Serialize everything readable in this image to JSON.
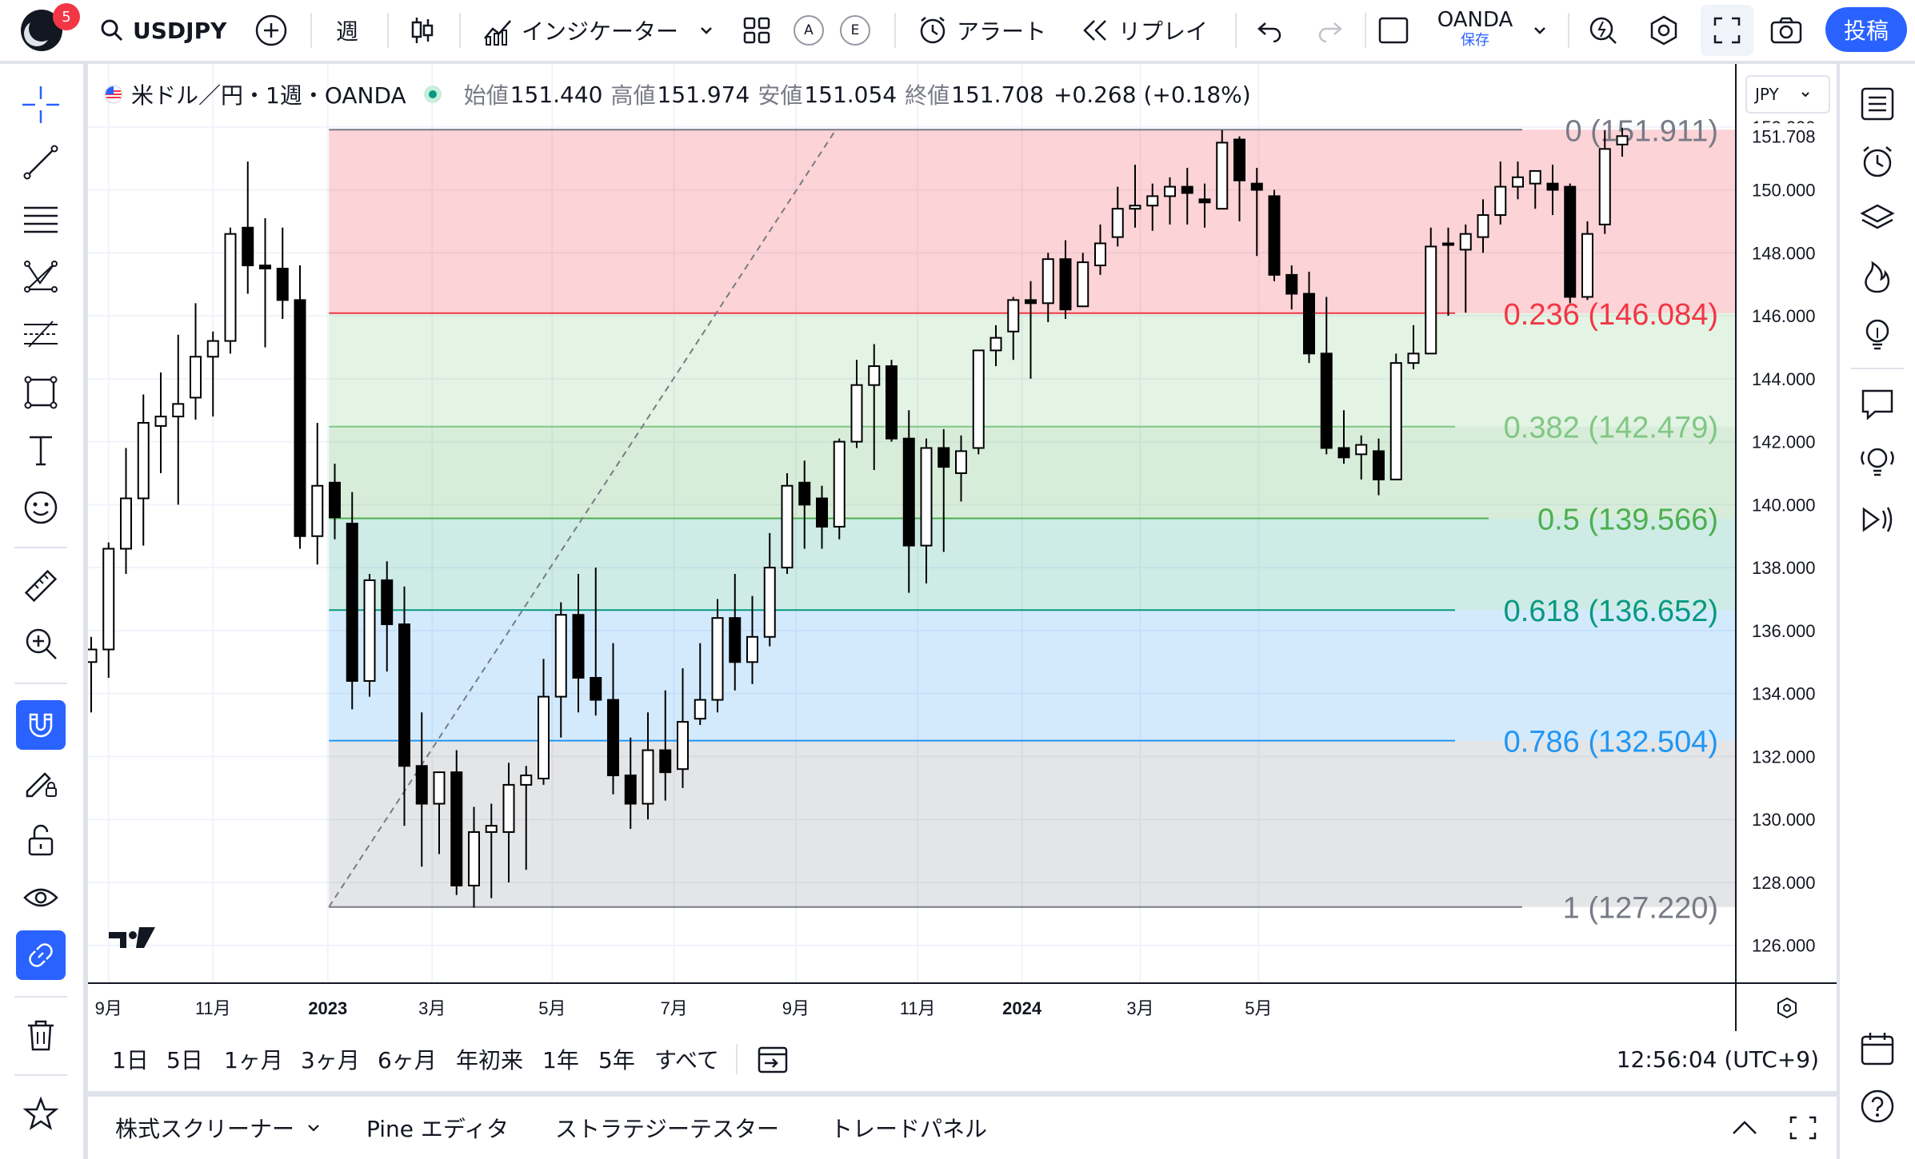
{
  "header": {
    "notification_count": "5",
    "symbol": "USDJPY",
    "interval": "週",
    "indicators_label": "インジケーター",
    "alert_label": "アラート",
    "replay_label": "リプレイ",
    "layout_name": "OANDA",
    "layout_status": "保存",
    "post_label": "投稿",
    "circle_a": "A",
    "circle_e": "E"
  },
  "legend": {
    "title": "米ドル／円・1週・OANDA",
    "open_label": "始値",
    "open": "151.440",
    "high_label": "高値",
    "high": "151.974",
    "low_label": "安値",
    "low": "151.054",
    "close_label": "終値",
    "close": "151.708",
    "change": "+0.268 (+0.18%)"
  },
  "currency": "JPY",
  "price_axis": {
    "ticks": [
      "152.000",
      "150.000",
      "148.000",
      "146.000",
      "144.000",
      "142.000",
      "140.000",
      "138.000",
      "136.000",
      "134.000",
      "132.000",
      "130.000",
      "128.000",
      "126.000"
    ],
    "last_price": "151.708"
  },
  "time_axis": {
    "labels": [
      {
        "text": "9月",
        "bold": false
      },
      {
        "text": "11月",
        "bold": false
      },
      {
        "text": "2023",
        "bold": true
      },
      {
        "text": "3月",
        "bold": false
      },
      {
        "text": "5月",
        "bold": false
      },
      {
        "text": "7月",
        "bold": false
      },
      {
        "text": "9月",
        "bold": false
      },
      {
        "text": "11月",
        "bold": false
      },
      {
        "text": "2024",
        "bold": true
      },
      {
        "text": "3月",
        "bold": false
      },
      {
        "text": "5月",
        "bold": false
      }
    ]
  },
  "ranges": [
    "1日",
    "5日",
    "1ヶ月",
    "3ヶ月",
    "6ヶ月",
    "年初来",
    "1年",
    "5年",
    "すべて"
  ],
  "clock": "12:56:04 (UTC+9)",
  "bottom_tabs": {
    "screener": "株式スクリーナー",
    "pine": "Pine エディタ",
    "strategy": "ストラテジーテスター",
    "trade": "トレードパネル"
  },
  "colors": {
    "accent": "#2962ff",
    "level_0": "#787b86",
    "level_0236": "#f23645",
    "level_0382": "#81c784",
    "level_05": "#4caf50",
    "level_0618": "#089981",
    "level_0786": "#2196f3",
    "level_1": "#787b86"
  },
  "chart_data": {
    "type": "candlestick",
    "title": "米ドル／円・1週・OANDA",
    "ylim": [
      124.8,
      154.0
    ],
    "y_ticks": [
      126,
      128,
      130,
      132,
      134,
      136,
      138,
      140,
      142,
      144,
      146,
      148,
      150,
      152
    ],
    "fibonacci": [
      {
        "ratio": "0",
        "price": 151.911,
        "label": "0 (151.911)"
      },
      {
        "ratio": "0.236",
        "price": 146.084,
        "label": "0.236 (146.084)"
      },
      {
        "ratio": "0.382",
        "price": 142.479,
        "label": "0.382 (142.479)"
      },
      {
        "ratio": "0.5",
        "price": 139.566,
        "label": "0.5 (139.566)"
      },
      {
        "ratio": "0.618",
        "price": 136.652,
        "label": "0.618 (136.652)"
      },
      {
        "ratio": "0.786",
        "price": 132.504,
        "label": "0.786 (132.504)"
      },
      {
        "ratio": "1",
        "price": 127.22,
        "label": "1 (127.220)"
      }
    ],
    "candles": [
      [
        135.0,
        135.8,
        133.4,
        135.4
      ],
      [
        135.4,
        138.8,
        134.5,
        138.6
      ],
      [
        138.6,
        141.8,
        137.8,
        140.2
      ],
      [
        140.2,
        143.5,
        138.7,
        142.6
      ],
      [
        142.5,
        144.2,
        141.0,
        142.8
      ],
      [
        142.8,
        145.4,
        140.0,
        143.2
      ],
      [
        143.4,
        146.4,
        142.7,
        144.7
      ],
      [
        144.7,
        145.5,
        142.8,
        145.2
      ],
      [
        145.2,
        148.8,
        144.8,
        148.6
      ],
      [
        148.8,
        150.9,
        146.7,
        147.6
      ],
      [
        147.6,
        149.1,
        145.0,
        147.5
      ],
      [
        147.5,
        148.8,
        145.9,
        146.5
      ],
      [
        146.5,
        147.6,
        138.6,
        139.0
      ],
      [
        139.0,
        142.6,
        138.1,
        140.6
      ],
      [
        140.7,
        141.3,
        138.9,
        139.6
      ],
      [
        139.4,
        140.4,
        133.5,
        134.4
      ],
      [
        134.4,
        137.8,
        133.9,
        137.6
      ],
      [
        137.6,
        138.2,
        134.7,
        136.2
      ],
      [
        136.2,
        137.4,
        129.8,
        131.7
      ],
      [
        131.7,
        133.4,
        128.5,
        130.5
      ],
      [
        130.5,
        131.5,
        128.9,
        131.5
      ],
      [
        131.5,
        132.2,
        127.6,
        127.9
      ],
      [
        127.9,
        130.4,
        127.2,
        129.6
      ],
      [
        129.6,
        130.5,
        127.5,
        129.8
      ],
      [
        129.6,
        131.8,
        128.0,
        131.1
      ],
      [
        131.1,
        131.7,
        128.4,
        131.4
      ],
      [
        131.3,
        135.1,
        131.1,
        133.9
      ],
      [
        133.9,
        136.9,
        132.6,
        136.5
      ],
      [
        136.5,
        137.8,
        133.4,
        134.5
      ],
      [
        134.5,
        138.0,
        133.3,
        133.8
      ],
      [
        133.8,
        135.6,
        130.8,
        131.4
      ],
      [
        131.4,
        132.6,
        129.7,
        130.5
      ],
      [
        130.5,
        133.4,
        130.0,
        132.2
      ],
      [
        132.2,
        134.1,
        130.6,
        131.5
      ],
      [
        131.6,
        134.8,
        131.0,
        133.1
      ],
      [
        133.2,
        135.6,
        133.0,
        133.8
      ],
      [
        133.8,
        137.0,
        133.4,
        136.4
      ],
      [
        136.4,
        137.8,
        134.1,
        135.0
      ],
      [
        135.0,
        137.1,
        134.3,
        135.8
      ],
      [
        135.8,
        139.1,
        135.5,
        138.0
      ],
      [
        138.0,
        141.0,
        137.8,
        140.6
      ],
      [
        140.7,
        141.4,
        138.6,
        140.0
      ],
      [
        140.2,
        140.6,
        138.6,
        139.3
      ],
      [
        139.3,
        142.1,
        138.9,
        142.0
      ],
      [
        142.0,
        144.6,
        141.8,
        143.8
      ],
      [
        143.8,
        145.1,
        141.1,
        144.4
      ],
      [
        144.4,
        144.6,
        142.0,
        142.1
      ],
      [
        142.1,
        143.0,
        137.2,
        138.7
      ],
      [
        138.7,
        142.1,
        137.5,
        141.8
      ],
      [
        141.8,
        142.4,
        138.5,
        141.2
      ],
      [
        141.0,
        142.2,
        140.1,
        141.7
      ],
      [
        141.8,
        144.8,
        141.6,
        144.9
      ],
      [
        144.9,
        145.7,
        144.4,
        145.3
      ],
      [
        145.5,
        146.6,
        144.6,
        146.5
      ],
      [
        146.5,
        147.1,
        144.0,
        146.4
      ],
      [
        146.4,
        148.0,
        145.8,
        147.8
      ],
      [
        147.8,
        148.4,
        145.9,
        146.2
      ],
      [
        146.3,
        148.0,
        146.3,
        147.7
      ],
      [
        147.6,
        148.9,
        147.3,
        148.3
      ],
      [
        148.5,
        150.1,
        148.2,
        149.4
      ],
      [
        149.4,
        150.8,
        148.8,
        149.5
      ],
      [
        149.5,
        150.2,
        148.7,
        149.8
      ],
      [
        149.8,
        150.4,
        148.9,
        150.1
      ],
      [
        150.1,
        150.7,
        148.9,
        149.9
      ],
      [
        149.7,
        150.2,
        148.8,
        149.6
      ],
      [
        149.4,
        151.9,
        149.4,
        151.5
      ],
      [
        151.6,
        151.7,
        149.0,
        150.3
      ],
      [
        150.2,
        150.7,
        147.9,
        150.0
      ],
      [
        149.8,
        150.0,
        147.1,
        147.3
      ],
      [
        147.3,
        147.6,
        146.2,
        146.7
      ],
      [
        146.7,
        147.4,
        144.5,
        144.8
      ],
      [
        144.8,
        146.6,
        141.6,
        141.8
      ],
      [
        141.8,
        143.0,
        141.3,
        141.5
      ],
      [
        141.6,
        142.2,
        140.8,
        141.9
      ],
      [
        141.7,
        142.1,
        140.3,
        140.8
      ],
      [
        140.8,
        144.8,
        140.8,
        144.5
      ],
      [
        144.5,
        145.7,
        144.3,
        144.8
      ],
      [
        144.8,
        148.8,
        144.8,
        148.2
      ],
      [
        148.3,
        148.8,
        146.0,
        148.3
      ],
      [
        148.1,
        148.9,
        146.1,
        148.6
      ],
      [
        148.5,
        149.7,
        148.0,
        149.2
      ],
      [
        149.2,
        150.9,
        148.9,
        150.1
      ],
      [
        150.1,
        150.9,
        149.7,
        150.4
      ],
      [
        150.2,
        150.6,
        149.4,
        150.6
      ],
      [
        150.2,
        150.8,
        149.2,
        150.0
      ],
      [
        150.1,
        150.2,
        146.4,
        146.6
      ],
      [
        146.6,
        149.0,
        146.5,
        148.6
      ],
      [
        148.9,
        151.9,
        148.6,
        151.3
      ],
      [
        151.44,
        151.974,
        151.054,
        151.708
      ]
    ]
  }
}
